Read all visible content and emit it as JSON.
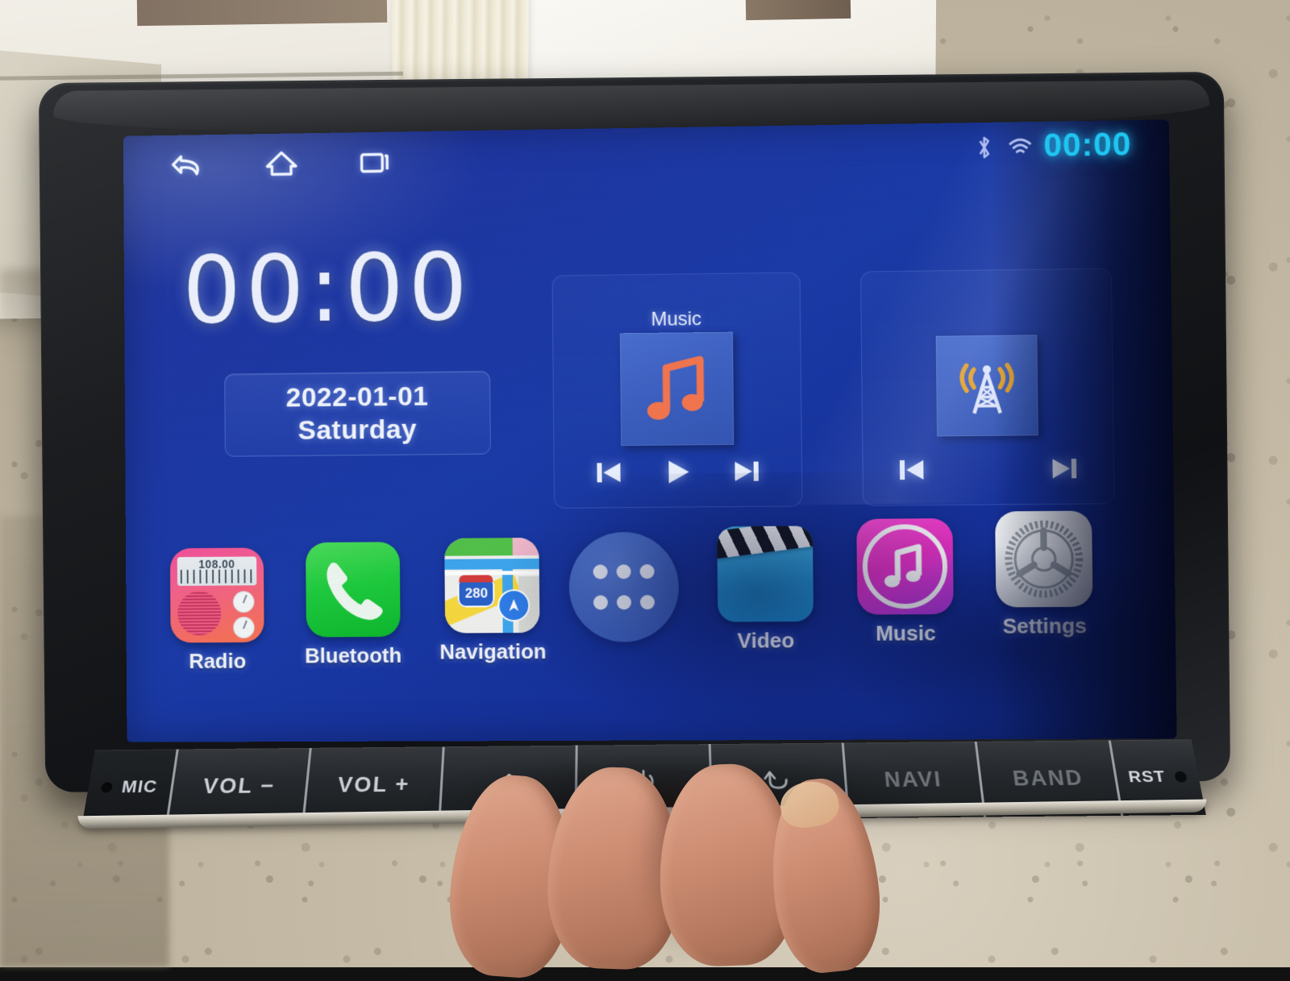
{
  "statusbar": {
    "nav": [
      {
        "name": "back-icon",
        "label": "Back"
      },
      {
        "name": "home-icon",
        "label": "Home"
      },
      {
        "name": "recents-icon",
        "label": "Recents"
      }
    ],
    "bluetooth_icon": "bluetooth-icon",
    "wifi_icon": "wifi-icon",
    "clock": "00:00",
    "clock_color": "#1fc6f2"
  },
  "home": {
    "big_clock": "00:00",
    "date": "2022-01-01",
    "weekday": "Saturday"
  },
  "widgets": {
    "music": {
      "title": "Music",
      "art_icon": "music-note-icon",
      "art_color": "#f4764f",
      "controls": [
        {
          "name": "prev-button",
          "label": "Previous"
        },
        {
          "name": "play-button",
          "label": "Play"
        },
        {
          "name": "next-button",
          "label": "Next"
        }
      ]
    },
    "radio": {
      "title": "",
      "art_icon": "radio-tower-icon",
      "art_color": "#f0a826",
      "controls": [
        {
          "name": "prev-button",
          "label": "Previous"
        },
        {
          "name": "next-button",
          "label": "Next"
        }
      ]
    }
  },
  "dock": [
    {
      "label": "Radio",
      "icon": "radio-app-icon",
      "frequency": "108.00",
      "color": "#f2529b"
    },
    {
      "label": "Bluetooth",
      "icon": "phone-handset-icon",
      "color": "#1fcc3f"
    },
    {
      "label": "Navigation",
      "icon": "maps-icon",
      "route_shield": "280",
      "color": "#3ea7ef"
    },
    {
      "label": "",
      "icon": "app-drawer-icon",
      "color": "#3f63c2"
    },
    {
      "label": "Video",
      "icon": "clapperboard-icon",
      "color": "#29a8e8"
    },
    {
      "label": "Music",
      "icon": "itunes-music-icon",
      "color": "#e831c4"
    },
    {
      "label": "Settings",
      "icon": "gear-icon",
      "color": "#dfe3e8"
    }
  ],
  "hardware_buttons": [
    {
      "label": "MIC",
      "name": "mic-hole",
      "type": "label"
    },
    {
      "label": "VOL −",
      "name": "volume-down-button",
      "type": "text"
    },
    {
      "label": "VOL +",
      "name": "volume-up-button",
      "type": "text"
    },
    {
      "label": "",
      "name": "home-button",
      "type": "icon-home"
    },
    {
      "label": "",
      "name": "power-button",
      "type": "icon-power"
    },
    {
      "label": "",
      "name": "back-button",
      "type": "icon-back"
    },
    {
      "label": "NAVI",
      "name": "navi-button",
      "type": "text-dim"
    },
    {
      "label": "BAND",
      "name": "band-button",
      "type": "text-dim"
    },
    {
      "label": "RST",
      "name": "reset-button",
      "type": "reset"
    }
  ]
}
